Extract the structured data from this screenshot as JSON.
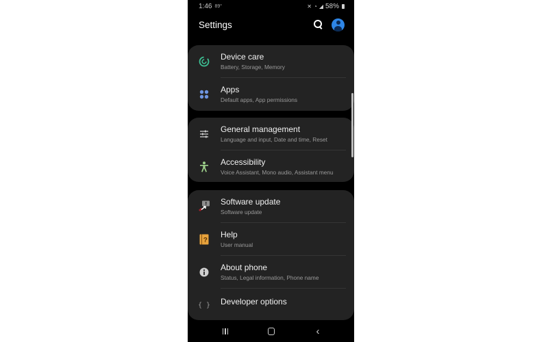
{
  "status_bar": {
    "time": "1:46",
    "temperature": "89°",
    "icons": [
      "mute-icon",
      "wifi-icon",
      "signal-icon"
    ],
    "battery": "58%"
  },
  "header": {
    "title": "Settings",
    "search_icon": "search-icon",
    "profile_icon": "account-icon"
  },
  "groups": [
    {
      "items": [
        {
          "id": "device-care",
          "icon": "device-care-icon",
          "label": "Device care",
          "subtitle": "Battery, Storage, Memory",
          "icon_color": "#3dbf93"
        },
        {
          "id": "apps",
          "icon": "apps-icon",
          "label": "Apps",
          "subtitle": "Default apps, App permissions",
          "icon_color": "#6e95e0"
        }
      ]
    },
    {
      "items": [
        {
          "id": "general-management",
          "icon": "sliders-icon",
          "label": "General management",
          "subtitle": "Language and input, Date and time, Reset",
          "icon_color": "#d0d0d0"
        },
        {
          "id": "accessibility",
          "icon": "accessibility-icon",
          "label": "Accessibility",
          "subtitle": "Voice Assistant, Mono audio, Assistant menu",
          "icon_color": "#9ccf8a"
        }
      ]
    },
    {
      "items": [
        {
          "id": "software-update",
          "icon": "software-update-icon",
          "label": "Software update",
          "subtitle": "Software update",
          "icon_color": "#9a9a9a"
        },
        {
          "id": "help",
          "icon": "help-icon",
          "label": "Help",
          "subtitle": "User manual",
          "icon_color": "#e8a33c"
        },
        {
          "id": "about-phone",
          "icon": "info-icon",
          "label": "About phone",
          "subtitle": "Status, Legal information, Phone name",
          "icon_color": "#cfcfcf"
        },
        {
          "id": "developer-options",
          "icon": "braces-icon",
          "label": "Developer options",
          "subtitle": "",
          "icon_color": "#9a9a9a"
        }
      ]
    }
  ],
  "nav_bar": {
    "recents": "recents-icon",
    "home": "home-icon",
    "back": "back-icon",
    "back_glyph": "‹"
  }
}
